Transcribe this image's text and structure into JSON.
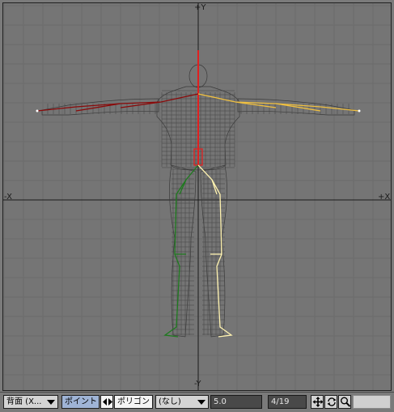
{
  "viewport": {
    "axis_labels": {
      "y_top": "+Y",
      "y_bottom": "-Y",
      "x_left": "-X",
      "x_right": "+X"
    },
    "colors": {
      "background": "#757575",
      "grid": "#6c6c6c",
      "axis": "#1a1a1a",
      "mesh": "#3c3c3c",
      "bone_spine": "#e02020",
      "bone_arm_right": "#7a0a0a",
      "bone_arm_left": "#f0c040",
      "bone_leg_right": "#1e7a1e",
      "bone_leg_left": "#fff3b0"
    }
  },
  "toolbar": {
    "view_select": "背面 (X...",
    "point_toggle": "ポイント",
    "swap_icon": "double-arrow-icon",
    "polygon_toggle": "ポリゴン",
    "layer_select": "(なし)",
    "value_field": "5.0",
    "layer_counter": "4/19",
    "move_icon": "move-icon",
    "rotate_icon": "rotate-icon",
    "zoom_icon": "magnifier-icon"
  }
}
